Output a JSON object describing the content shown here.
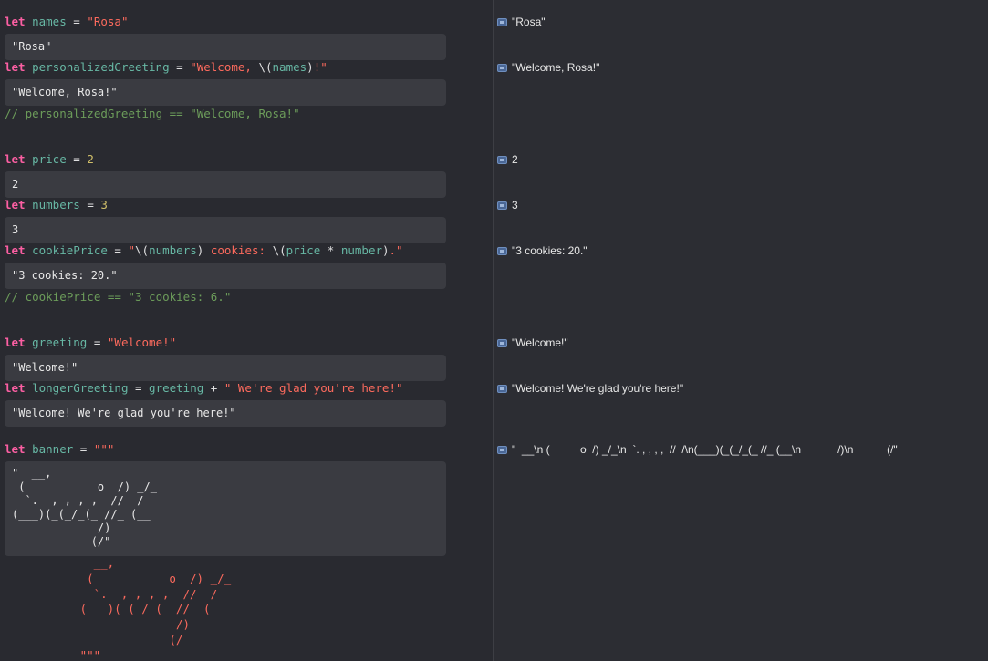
{
  "editor": {
    "lines": {
      "l1": {
        "kw": "let",
        "id": "names",
        "op": " = ",
        "val": "\"Rosa\""
      },
      "r1": "\"Rosa\"",
      "l2": {
        "kw": "let",
        "id": "personalizedGreeting",
        "op": " = ",
        "s1": "\"Welcome, ",
        "interp_open": "\\(",
        "arg": "names",
        "interp_close": ")",
        "s2": "!\""
      },
      "r2": "\"Welcome, Rosa!\"",
      "c1": "// personalizedGreeting == \"Welcome, Rosa!\"",
      "l3": {
        "kw": "let",
        "id": "price",
        "op": " = ",
        "val": "2"
      },
      "r3": "2",
      "l4": {
        "kw": "let",
        "id": "numbers",
        "op": " = ",
        "val": "3"
      },
      "r4": "3",
      "l5": {
        "kw": "let",
        "id": "cookiePrice",
        "op": " = ",
        "s1": "\"",
        "i1o": "\\(",
        "a1": "numbers",
        "i1c": ")",
        "s2": " cookies: ",
        "i2o": "\\(",
        "a2": "price",
        "mul": " * ",
        "a3": "number",
        "i2c": ")",
        "s3": ".\""
      },
      "r5": "\"3 cookies: 20.\"",
      "c2": "// cookiePrice == \"3 cookies: 6.\"",
      "l6": {
        "kw": "let",
        "id": "greeting",
        "op": " = ",
        "val": "\"Welcome!\""
      },
      "r6": "\"Welcome!\"",
      "l7": {
        "kw": "let",
        "id": "longerGreeting",
        "op": " = ",
        "a": "greeting",
        "plus": " + ",
        "val": "\" We're glad you're here!\""
      },
      "r7": "\"Welcome! We're glad you're here!\"",
      "l8": {
        "kw": "let",
        "id": "banner",
        "op": " = ",
        "val": "\"\"\""
      },
      "r8": "\"  __,\n (           o  /) _/_\n  `.  , , , ,  //  /\n(___)(_(_/_(_ //_ (__\n             /)\n            (/\"",
      "art": "     __,\n    (           o  /) _/_\n     `.  , , , ,  //  /\n   (___)(_(_/_(_ //_ (__\n                 /)\n                (/\n   \"\"\""
    }
  },
  "results": {
    "r1": "\"Rosa\"",
    "r2": "\"Welcome, Rosa!\"",
    "r3": "2",
    "r4": "3",
    "r5": "\"3 cookies: 20.\"",
    "r6": "\"Welcome!\"",
    "r7": "\"Welcome! We're glad you're here!\"",
    "r8": "\"  __\\n (          o  /) _/_\\n  `. , , , ,  //  /\\n(___)(_(_/_(_ //_ (__\\n            /)\\n           (/\""
  },
  "colors": {
    "keyword": "#fc5fa3",
    "identifier": "#67b7a4",
    "string": "#fc6a5d",
    "number": "#d0bf69",
    "comment": "#6c9c5a"
  }
}
